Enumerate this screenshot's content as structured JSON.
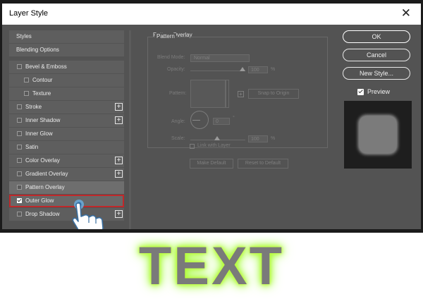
{
  "dialog": {
    "title": "Layer Style",
    "close_symbol": "✕"
  },
  "styles_list": {
    "items": [
      {
        "label": "Styles",
        "has_checkbox": false,
        "checked": false,
        "has_plus": false,
        "indent": 0
      },
      {
        "label": "Blending Options",
        "has_checkbox": false,
        "checked": false,
        "has_plus": false,
        "indent": 0
      },
      {
        "label": "Bevel & Emboss",
        "has_checkbox": true,
        "checked": false,
        "has_plus": false,
        "indent": 0
      },
      {
        "label": "Contour",
        "has_checkbox": true,
        "checked": false,
        "has_plus": false,
        "indent": 1
      },
      {
        "label": "Texture",
        "has_checkbox": true,
        "checked": false,
        "has_plus": false,
        "indent": 1
      },
      {
        "label": "Stroke",
        "has_checkbox": true,
        "checked": false,
        "has_plus": true,
        "indent": 0
      },
      {
        "label": "Inner Shadow",
        "has_checkbox": true,
        "checked": false,
        "has_plus": true,
        "indent": 0
      },
      {
        "label": "Inner Glow",
        "has_checkbox": true,
        "checked": false,
        "has_plus": false,
        "indent": 0
      },
      {
        "label": "Satin",
        "has_checkbox": true,
        "checked": false,
        "has_plus": false,
        "indent": 0
      },
      {
        "label": "Color Overlay",
        "has_checkbox": true,
        "checked": false,
        "has_plus": true,
        "indent": 0
      },
      {
        "label": "Gradient Overlay",
        "has_checkbox": true,
        "checked": false,
        "has_plus": true,
        "indent": 0
      },
      {
        "label": "Pattern Overlay",
        "has_checkbox": true,
        "checked": false,
        "has_plus": false,
        "indent": 0,
        "active": true
      },
      {
        "label": "Outer Glow",
        "has_checkbox": true,
        "checked": true,
        "has_plus": false,
        "indent": 0,
        "selected": true
      },
      {
        "label": "Drop Shadow",
        "has_checkbox": true,
        "checked": false,
        "has_plus": true,
        "indent": 0
      }
    ]
  },
  "pattern_overlay": {
    "section_title": "Pattern Overlay",
    "group_title": "Pattern",
    "blend_mode_label": "Blend Mode:",
    "blend_mode_value": "Normal",
    "opacity_label": "Opacity:",
    "opacity_value": "100",
    "opacity_unit": "%",
    "pattern_label": "Pattern:",
    "snap_to_origin": "Snap to Origin",
    "angle_label": "Angle:",
    "angle_value": "0",
    "angle_unit": "°",
    "scale_label": "Scale:",
    "scale_value": "100",
    "scale_unit": "%",
    "link_with_layer": "Link with Layer",
    "make_default": "Make Default",
    "reset_to_default": "Reset to Default"
  },
  "actions": {
    "ok": "OK",
    "cancel": "Cancel",
    "new_style": "New Style...",
    "preview": "Preview",
    "preview_checked": true
  },
  "demo_text": "TEXT",
  "colors": {
    "dialog_bg": "#535353",
    "selection_border": "#c0282a",
    "glow": "#b6ff30",
    "text_fill": "#7a7a7a"
  }
}
